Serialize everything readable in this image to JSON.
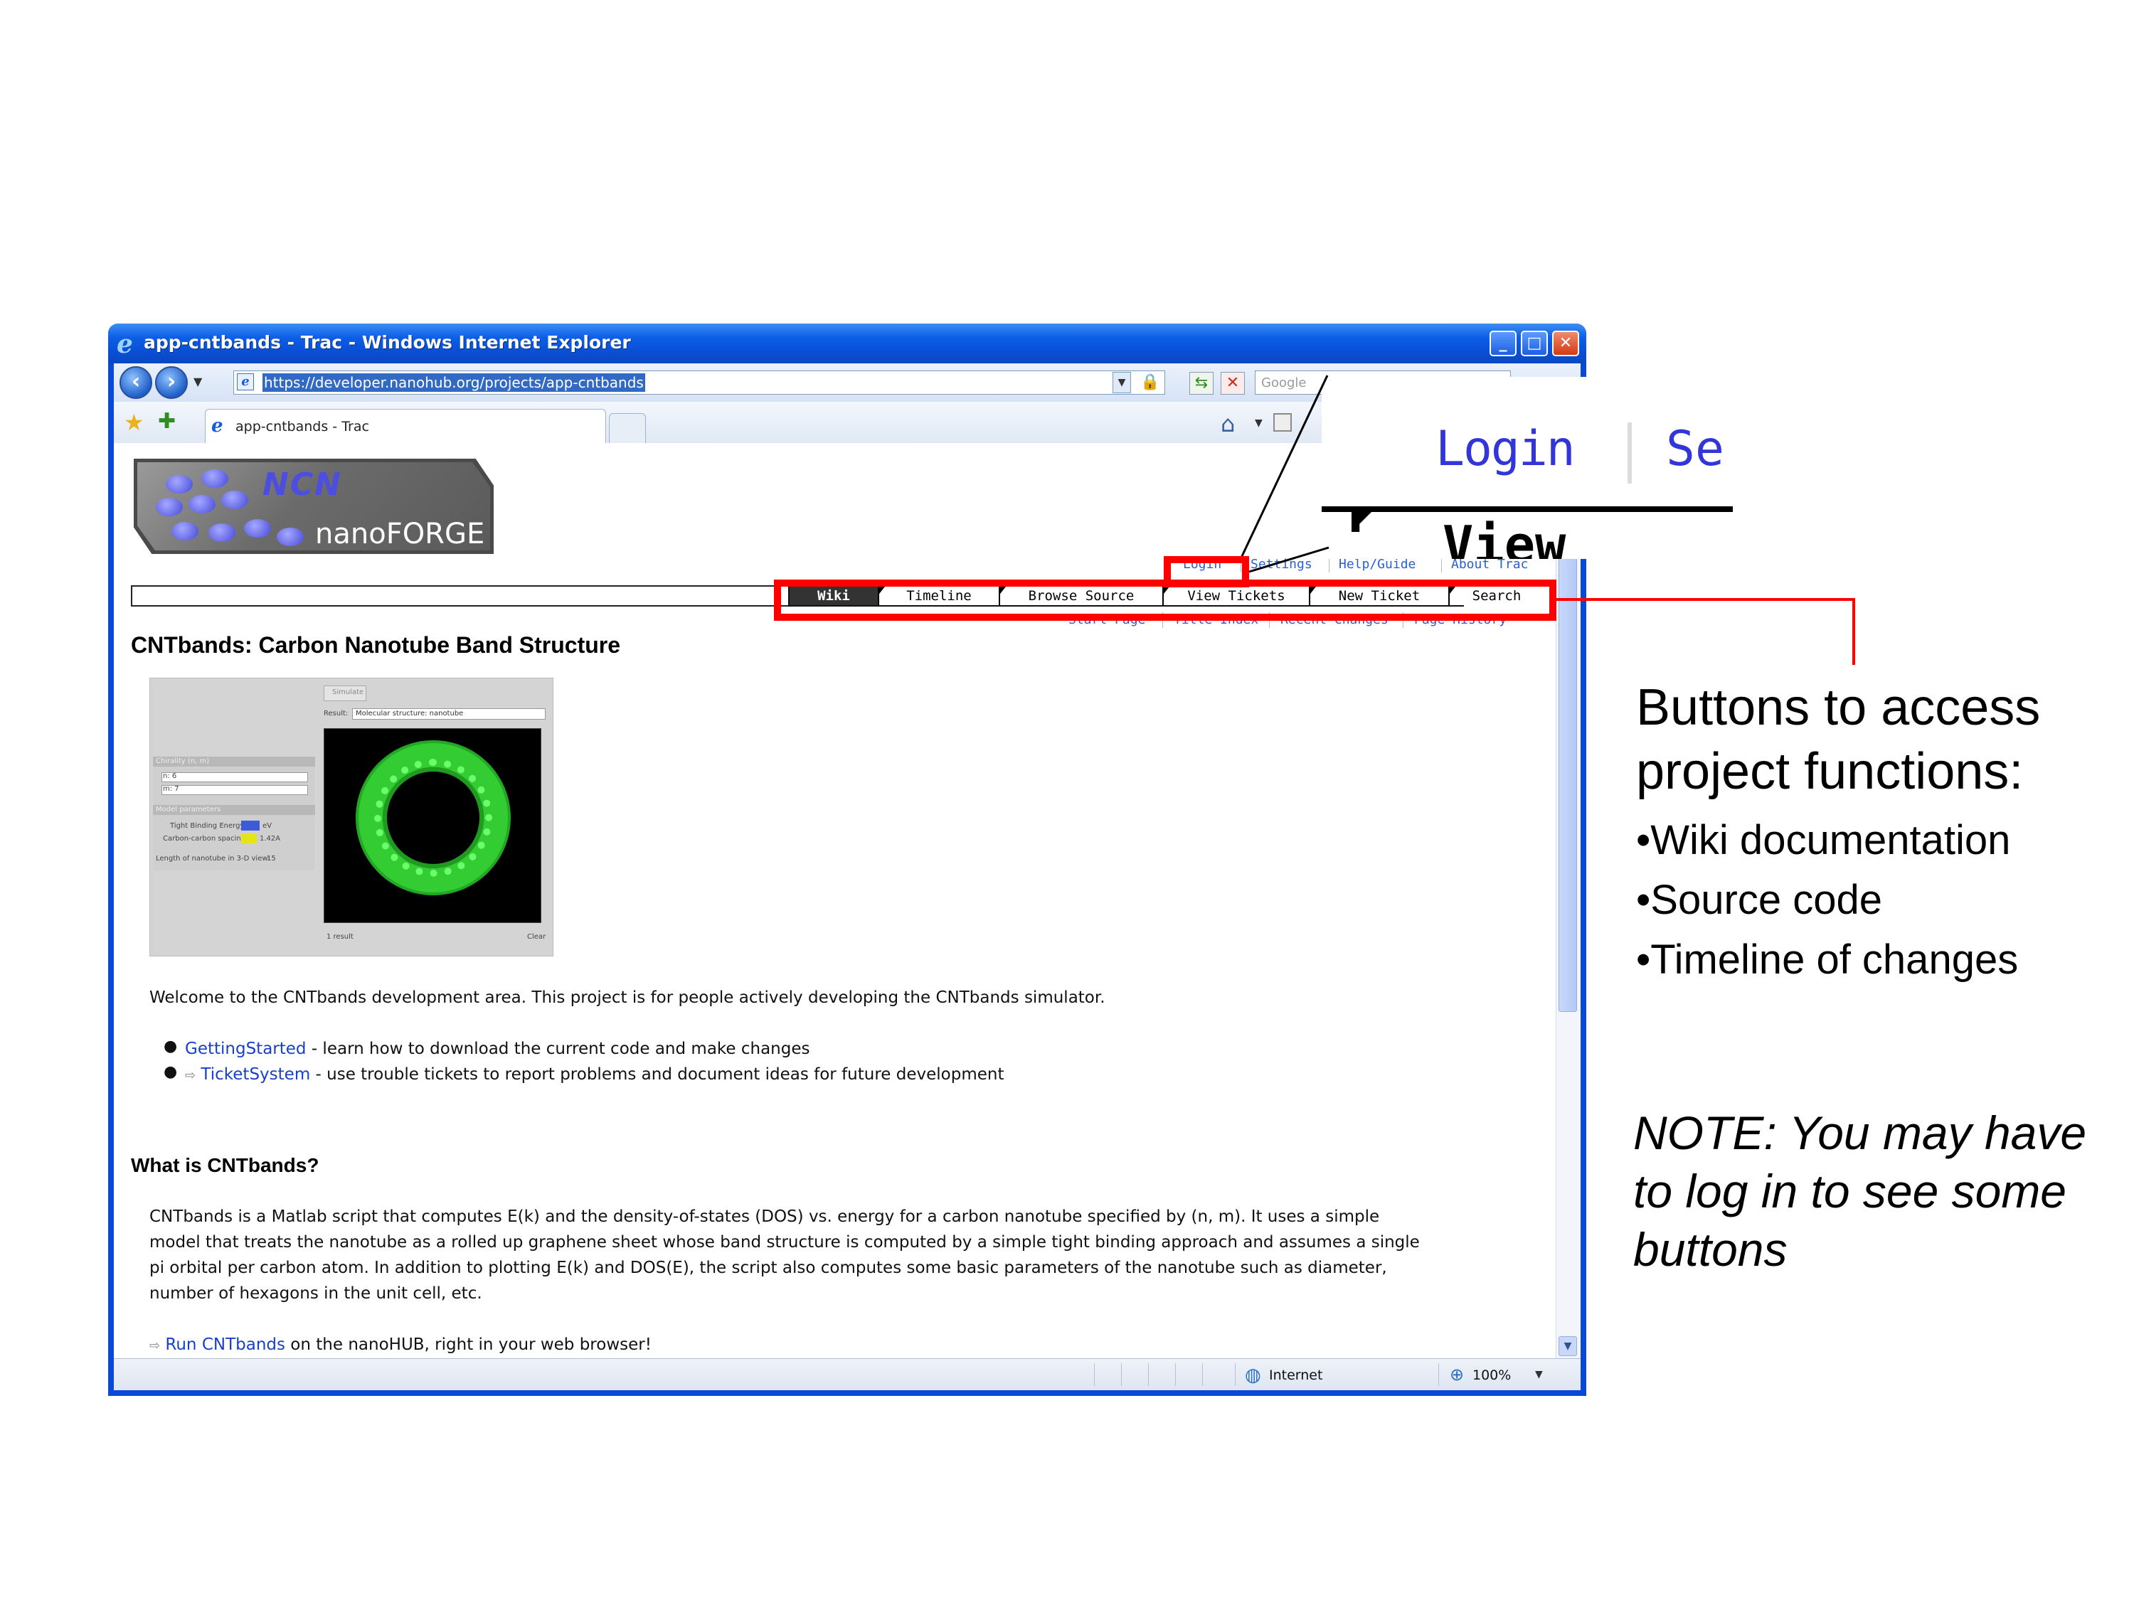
{
  "window": {
    "title": "app-cntbands - Trac - Windows Internet Explorer",
    "minimize": "_",
    "maximize": "□",
    "close": "✕"
  },
  "address_bar": {
    "url": "https://developer.nanohub.org/projects/app-cntbands",
    "search_placeholder": "Google"
  },
  "tabs": [
    {
      "label": "app-cntbands - Trac"
    }
  ],
  "logo": {
    "ncn": "NCN",
    "forge": "nanoFORGE"
  },
  "meta_nav": [
    "Login",
    "Settings",
    "Help/Guide",
    "About Trac"
  ],
  "main_nav": [
    "Wiki",
    "Timeline",
    "Browse Source",
    "View Tickets",
    "New Ticket",
    "Search"
  ],
  "context_nav": [
    "Start Page",
    "Title Index",
    "Recent Changes",
    "Page History"
  ],
  "page": {
    "heading": "CNTbands: Carbon Nanotube Band Structure",
    "app_result_label": "Result:",
    "app_result_value": "Molecular structure: nanotube",
    "app_simulate_label": "Simulate",
    "app_chirality_label": "Chirality (n, m)",
    "app_n": "n:  6",
    "app_m": "m:  7",
    "app_params_label": "Model parameters",
    "app_energy_label": "Tight Binding Energy",
    "app_energy_unit": "eV",
    "app_spacing_label": "Carbon-carbon spacing",
    "app_spacing_value": "1.42A",
    "app_length_label": "Length of nanotube in 3-D view:",
    "app_length_value": "15",
    "app_results_count": "1 result",
    "app_clear": "Clear",
    "welcome": "Welcome to the CNTbands development area. This project is for people actively developing the CNTbands simulator.",
    "links": [
      {
        "link": "GettingStarted",
        "text": " - learn how to download the current code and make changes"
      },
      {
        "link": "TicketSystem",
        "text": " - use trouble tickets to report problems and document ideas for future development"
      }
    ],
    "section_heading": "What is CNTbands?",
    "description": [
      "CNTbands is a Matlab script that computes E(k) and the density-of-states (DOS) vs. energy for a carbon nanotube specified by (n, m). It uses a simple",
      "model that treats the nanotube as a rolled up graphene sheet whose band structure is computed by a simple tight binding approach and assumes a single",
      "pi orbital per carbon atom. In addition to plotting E(k) and DOS(E), the script also computes some basic parameters of the nanotube such as diameter,",
      "number of hexagons in the unit cell, etc."
    ],
    "run_link": "Run CNTbands",
    "run_text": " on the nanoHUB, right in your web browser!"
  },
  "status_bar": {
    "zone": "Internet",
    "zoom": "100%"
  },
  "zoom_callout": {
    "login": "Login",
    "settings": "Se",
    "view_tickets": "View Ticket"
  },
  "annotation": {
    "title": "Buttons to access project functions:",
    "bullets": [
      "•Wiki documentation",
      "•Source code",
      "•Timeline of changes"
    ],
    "note": "NOTE:  You may have to log in to see some buttons"
  },
  "colors": {
    "highlight": "#ff0000",
    "link": "#1a40c9",
    "ie_blue": "#0a48d8"
  }
}
